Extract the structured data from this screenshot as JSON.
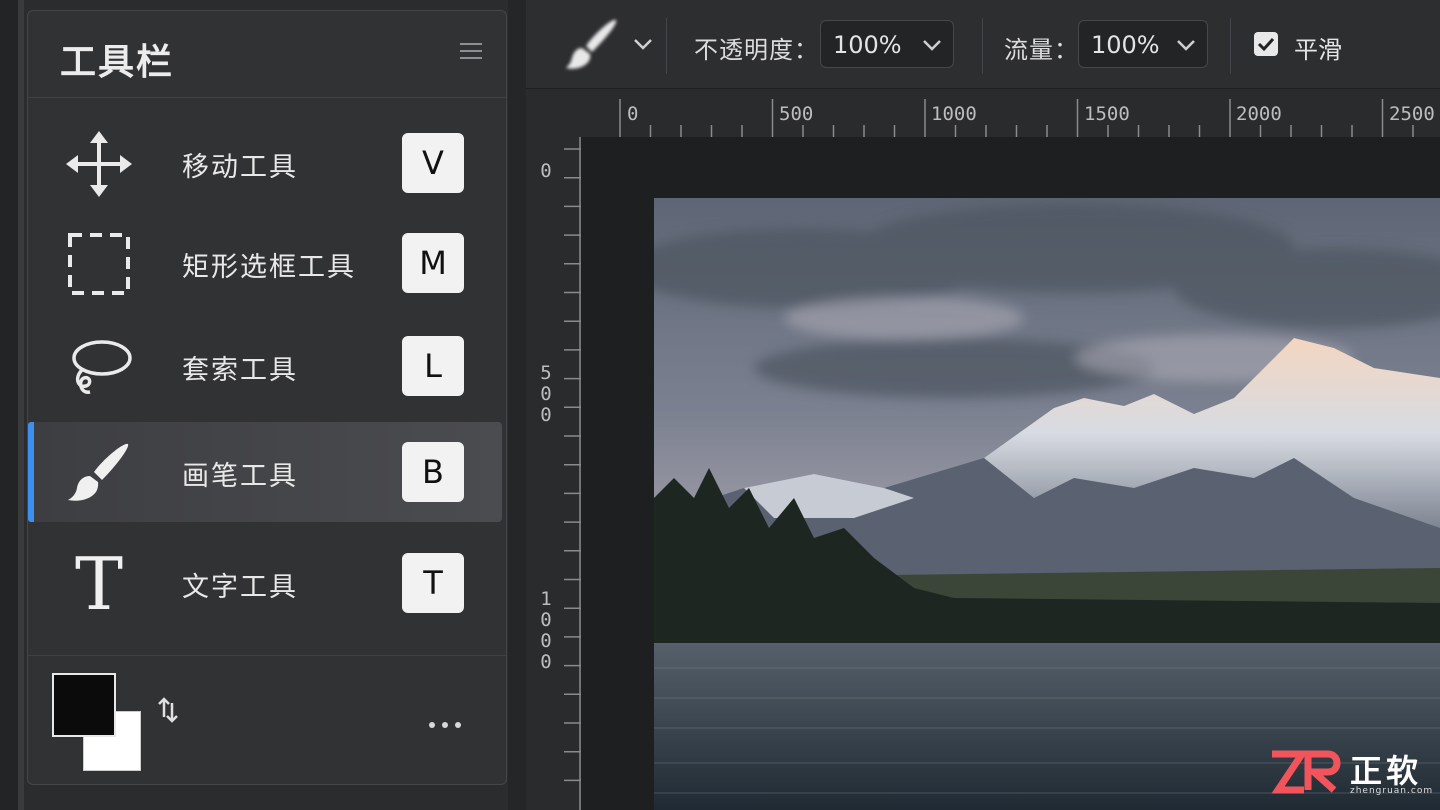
{
  "panel": {
    "title": "工具栏",
    "tools": [
      {
        "label": "移动工具",
        "shortcut": "V",
        "icon": "move-icon",
        "active": false
      },
      {
        "label": "矩形选框工具",
        "shortcut": "M",
        "icon": "rect-marquee-icon",
        "active": false
      },
      {
        "label": "套索工具",
        "shortcut": "L",
        "icon": "lasso-icon",
        "active": false
      },
      {
        "label": "画笔工具",
        "shortcut": "B",
        "icon": "brush-icon",
        "active": true
      },
      {
        "label": "文字工具",
        "shortcut": "T",
        "icon": "text-icon",
        "active": false
      }
    ],
    "text_icon_glyph": "T",
    "foreground_color": "#0b0b0b",
    "background_color": "#ffffff"
  },
  "options": {
    "opacity_label": "不透明度：",
    "opacity_value": "100%",
    "flow_label": "流量：",
    "flow_value": "100%",
    "smooth_label": "平滑",
    "smooth_checked": true
  },
  "ruler": {
    "top_labels": [
      "0",
      "500",
      "1000",
      "1500",
      "2000",
      "2500"
    ],
    "left_labels": [
      [
        "0"
      ],
      [
        "5",
        "0",
        "0"
      ],
      [
        "1",
        "0",
        "0",
        "0"
      ]
    ]
  },
  "watermark": {
    "brand": "正软",
    "url": "zhengruan.com"
  },
  "colors": {
    "accent": "#3d8ff2",
    "panel_bg": "#313234"
  }
}
